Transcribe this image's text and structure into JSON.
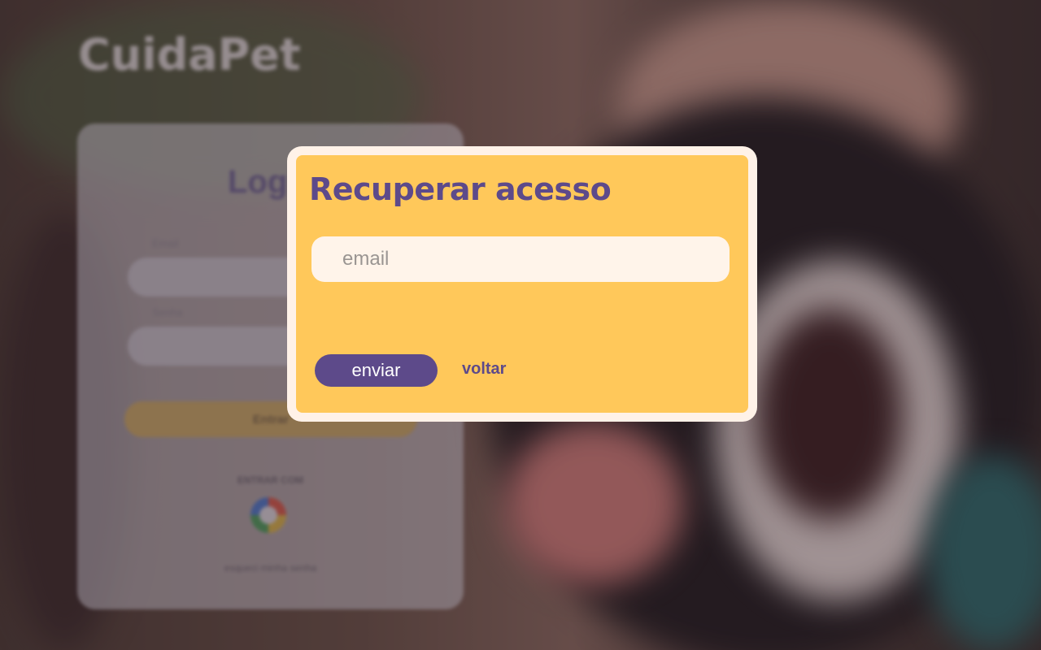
{
  "app": {
    "logo_text": "CuidaPet"
  },
  "login": {
    "title": "Login",
    "email_label": "Email",
    "password_label": "Senha",
    "submit_label": "Entrar",
    "login_with": "ENTRAR COM",
    "forgot_link": "esqueci minha senha"
  },
  "modal": {
    "title": "Recuperar acesso",
    "email_placeholder": "email",
    "send_label": "enviar",
    "back_label": "voltar"
  },
  "colors": {
    "accent_yellow": "#ffc85a",
    "accent_purple": "#5d4a8a",
    "modal_border": "#fff2e8"
  },
  "icons": {
    "google": "google-icon"
  }
}
